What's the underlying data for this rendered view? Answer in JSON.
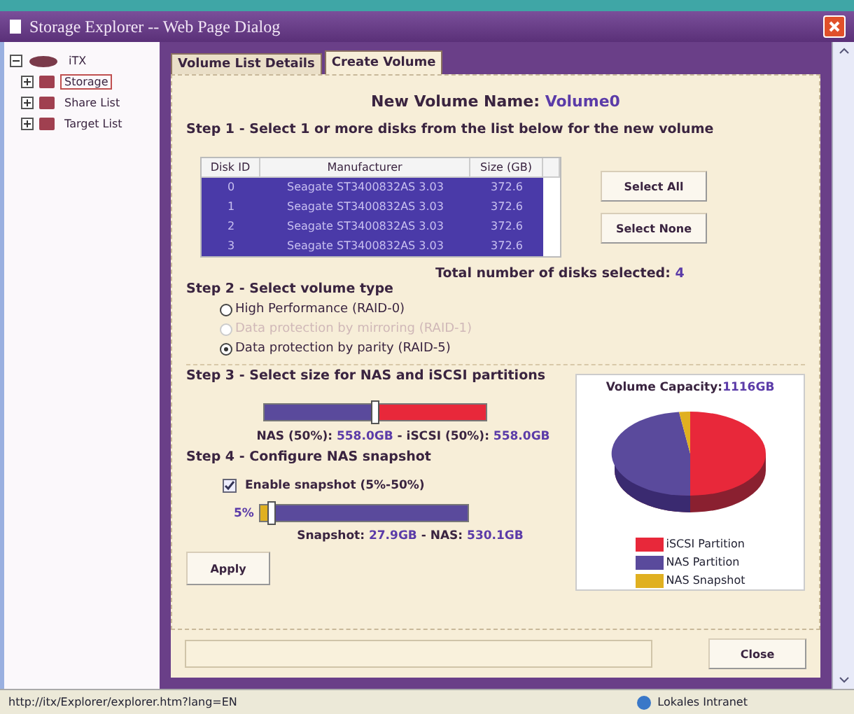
{
  "window": {
    "title": "Storage Explorer -- Web Page Dialog"
  },
  "tree": [
    {
      "label": "iTX",
      "expanded": true,
      "selected": false,
      "children": [
        {
          "label": "Storage",
          "expanded": false,
          "selected": true
        },
        {
          "label": "Share List",
          "expanded": false,
          "selected": false
        },
        {
          "label": "Target List",
          "expanded": false,
          "selected": false
        }
      ]
    }
  ],
  "tabs": [
    {
      "label": "Volume List Details",
      "selected": false
    },
    {
      "label": "Create Volume",
      "selected": true
    }
  ],
  "volume_name": {
    "label": "New Volume Name:",
    "value": "Volume0"
  },
  "step1": {
    "title": "Step 1 - Select 1 or more disks from the list below for the new volume",
    "table": {
      "columns": [
        "Disk ID",
        "Manufacturer",
        "Size (GB)"
      ],
      "rows": [
        {
          "cells": [
            "0",
            "Seagate ST3400832AS 3.03",
            "372.6"
          ],
          "selected": true
        },
        {
          "cells": [
            "1",
            "Seagate ST3400832AS 3.03",
            "372.6"
          ],
          "selected": true
        },
        {
          "cells": [
            "2",
            "Seagate ST3400832AS 3.03",
            "372.6"
          ],
          "selected": true
        },
        {
          "cells": [
            "3",
            "Seagate ST3400832AS 3.03",
            "372.6"
          ],
          "selected": true
        }
      ]
    },
    "buttons": [
      "Select All",
      "Select None"
    ],
    "total": {
      "label": "Total number of disks selected:",
      "value": "4"
    }
  },
  "step2": {
    "title": "Step 2 - Select volume type",
    "options": [
      {
        "label": "High Performance (RAID-0)",
        "selected": false,
        "disabled": false
      },
      {
        "label": "Data protection by mirroring (RAID-1)",
        "selected": false,
        "disabled": true
      },
      {
        "label": "Data protection by parity (RAID-5)",
        "selected": true,
        "disabled": false
      }
    ]
  },
  "step3": {
    "title": "Step 3 - Select size for NAS and iSCSI partitions",
    "level": 0.5,
    "summary": [
      {
        "text": "NAS (50%):",
        "kind": "label"
      },
      {
        "text": "558.0GB",
        "kind": "value"
      },
      {
        "text": "- iSCSI (50%):",
        "kind": "label"
      },
      {
        "text": "558.0GB",
        "kind": "value"
      }
    ]
  },
  "step4": {
    "title": "Step 4 - Configure NAS snapshot",
    "checkbox": {
      "label": "Enable snapshot (5%-50%)",
      "checked": true
    },
    "slider_label": "5%",
    "level": 0.05,
    "summary": [
      {
        "text": "Snapshot:",
        "kind": "label"
      },
      {
        "text": "27.9GB",
        "kind": "value"
      },
      {
        "text": "- NAS:",
        "kind": "label"
      },
      {
        "text": "530.1GB",
        "kind": "value"
      }
    ]
  },
  "apply_button": "Apply",
  "capacity": {
    "label": "Volume Capacity:",
    "value": "1116GB",
    "legend": [
      {
        "label": "iSCSI Partition",
        "color": "#e8283a"
      },
      {
        "label": "NAS Partition",
        "color": "#5a4a9c"
      },
      {
        "label": "NAS Snapshot",
        "color": "#e0b020"
      }
    ]
  },
  "close_button": "Close",
  "status_bar": {
    "url": "http://itx/Explorer/explorer.htm?lang=EN",
    "zone": "Lokales Intranet"
  }
}
